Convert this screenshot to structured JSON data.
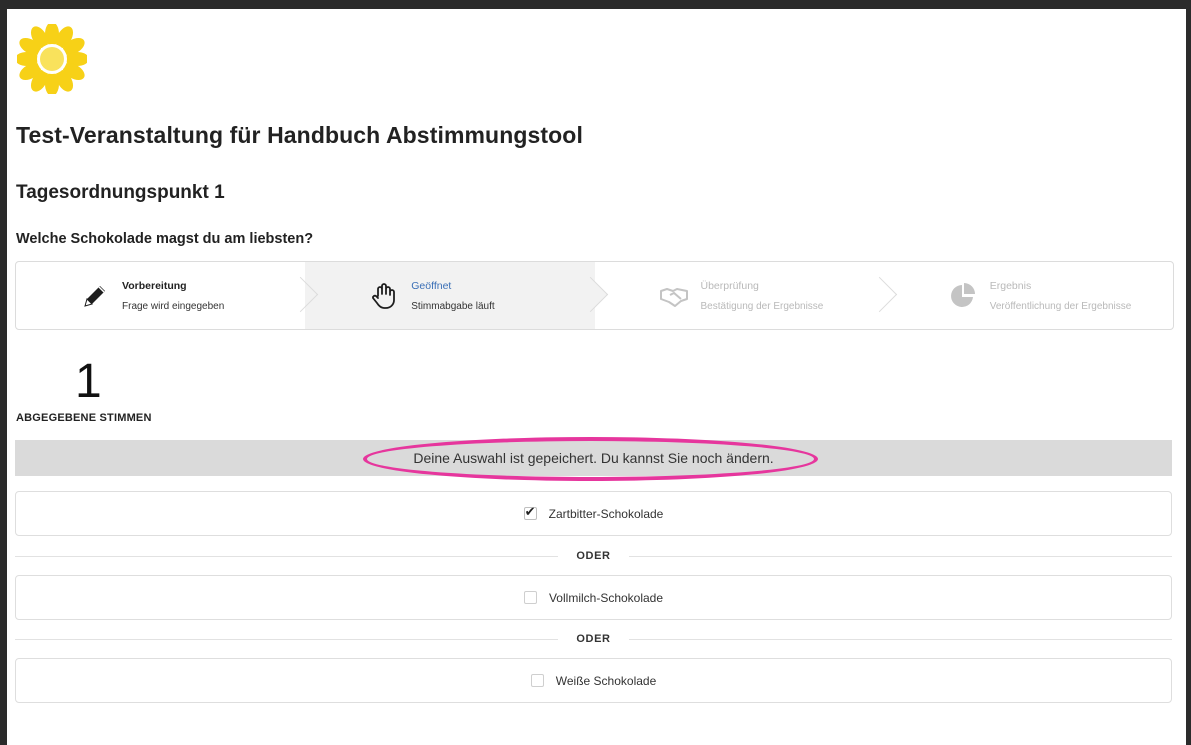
{
  "event": {
    "title": "Test-Veranstaltung für Handbuch Abstimmungstool",
    "agenda_item": "Tagesordnungspunkt 1",
    "question": "Welche Schokolade magst du am liebsten?"
  },
  "icons": {
    "logo": "sunflower-logo",
    "step1": "pencil-icon",
    "step2": "hand-icon",
    "step3": "handshake-icon",
    "step4": "pie-chart-icon"
  },
  "steps": [
    {
      "title": "Vorbereitung",
      "desc": "Frage wird eingegeben",
      "state": "done"
    },
    {
      "title": "Geöffnet",
      "desc": "Stimmabgabe läuft",
      "state": "active"
    },
    {
      "title": "Überprüfung",
      "desc": "Bestätigung der Ergebnisse",
      "state": "disabled"
    },
    {
      "title": "Ergebnis",
      "desc": "Veröffentlichung der Ergebnisse",
      "state": "disabled"
    }
  ],
  "votes": {
    "count": "1",
    "label": "ABGEGEBENE STIMMEN"
  },
  "notice": "Deine Auswahl ist gepeichert. Du kannst Sie noch ändern.",
  "separator": "ODER",
  "options": [
    {
      "label": "Zartbitter-Schokolade",
      "checked": true
    },
    {
      "label": "Vollmilch-Schokolade",
      "checked": false
    },
    {
      "label": "Weiße Schokolade",
      "checked": false
    }
  ],
  "colors": {
    "accent_blue": "#3a6fb6",
    "highlight_pink": "#e6369d",
    "notice_bg": "#dadada",
    "logo_yellow": "#f7d117"
  }
}
